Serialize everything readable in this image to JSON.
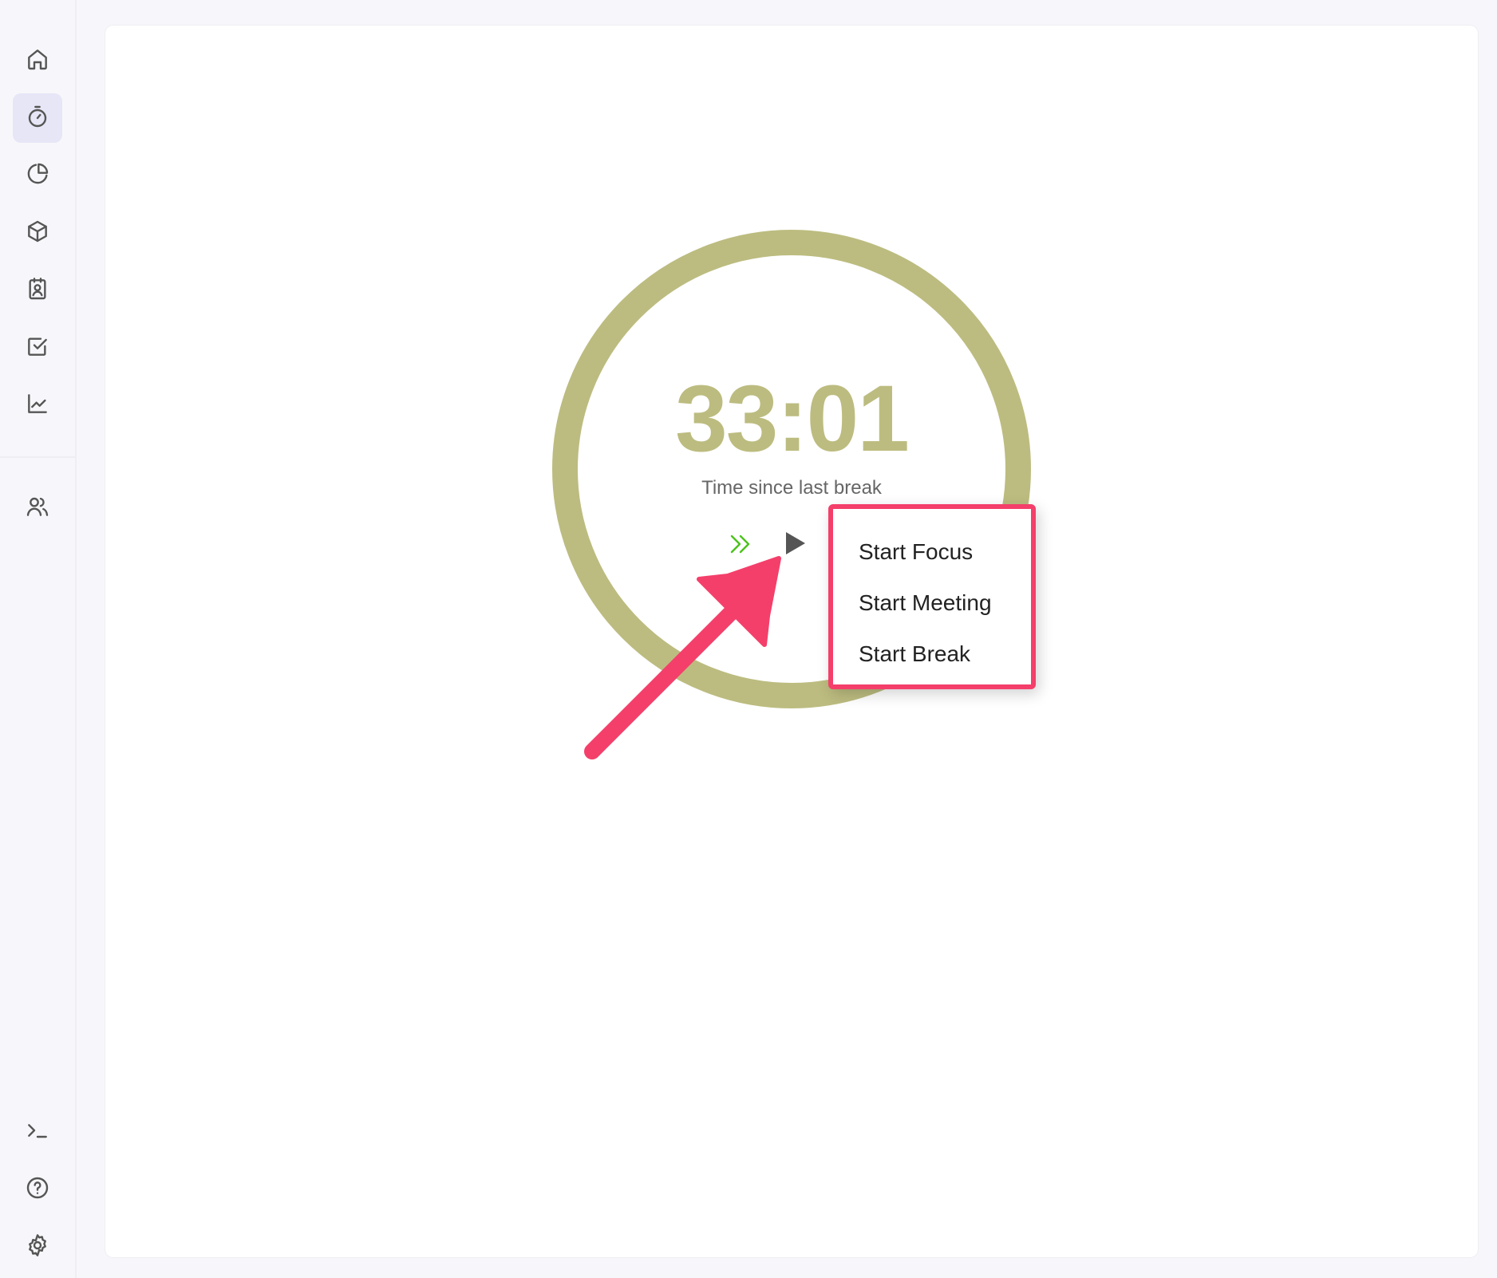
{
  "sidebar": {
    "items": [
      {
        "name": "home",
        "icon": "home-icon",
        "active": false
      },
      {
        "name": "timer",
        "icon": "stopwatch-icon",
        "active": true
      },
      {
        "name": "reports",
        "icon": "pie-chart-icon",
        "active": false
      },
      {
        "name": "projects",
        "icon": "cube-icon",
        "active": false
      },
      {
        "name": "clients",
        "icon": "contact-card-icon",
        "active": false
      },
      {
        "name": "tasks",
        "icon": "checkbox-icon",
        "active": false
      },
      {
        "name": "analytics",
        "icon": "line-chart-icon",
        "active": false
      },
      {
        "name": "team",
        "icon": "users-icon",
        "active": false
      }
    ],
    "bottom_items": [
      {
        "name": "terminal",
        "icon": "terminal-icon"
      },
      {
        "name": "help",
        "icon": "help-circle-icon"
      },
      {
        "name": "settings",
        "icon": "gear-icon"
      }
    ]
  },
  "timer": {
    "value": "33:01",
    "label": "Time since last break",
    "ring_color": "#bcbc80",
    "skip_icon": "double-chevron-right-icon",
    "skip_color": "#4cc21a",
    "play_icon": "play-icon"
  },
  "menu": {
    "border_color": "#f43f6a",
    "items": [
      {
        "label": "Start Focus"
      },
      {
        "label": "Start Meeting"
      },
      {
        "label": "Start Break"
      }
    ]
  },
  "annotation": {
    "type": "arrow",
    "color": "#f43f6a"
  }
}
